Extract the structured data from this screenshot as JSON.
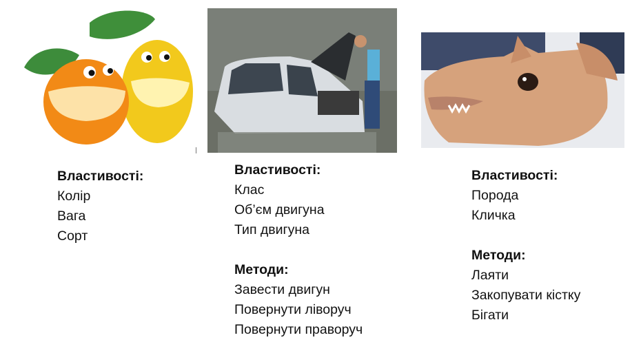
{
  "objects": [
    {
      "image_icon": "fruit-icon",
      "properties_heading": "Властивості:",
      "properties": [
        "Колір",
        "Вага",
        "Сорт"
      ]
    },
    {
      "image_icon": "car-icon",
      "properties_heading": "Властивості:",
      "properties": [
        "Клас",
        "Об’єм двигуна",
        "Тип двигуна"
      ],
      "methods_heading": "Методи:",
      "methods": [
        "Завести двигун",
        "Повернути ліворуч",
        "Повернути праворуч"
      ]
    },
    {
      "image_icon": "dog-icon",
      "properties_heading": "Властивості:",
      "properties": [
        "Порода",
        "Кличка"
      ],
      "methods_heading": "Методи:",
      "methods": [
        "Лаяти",
        "Закопувати кістку",
        "Бігати"
      ]
    }
  ]
}
